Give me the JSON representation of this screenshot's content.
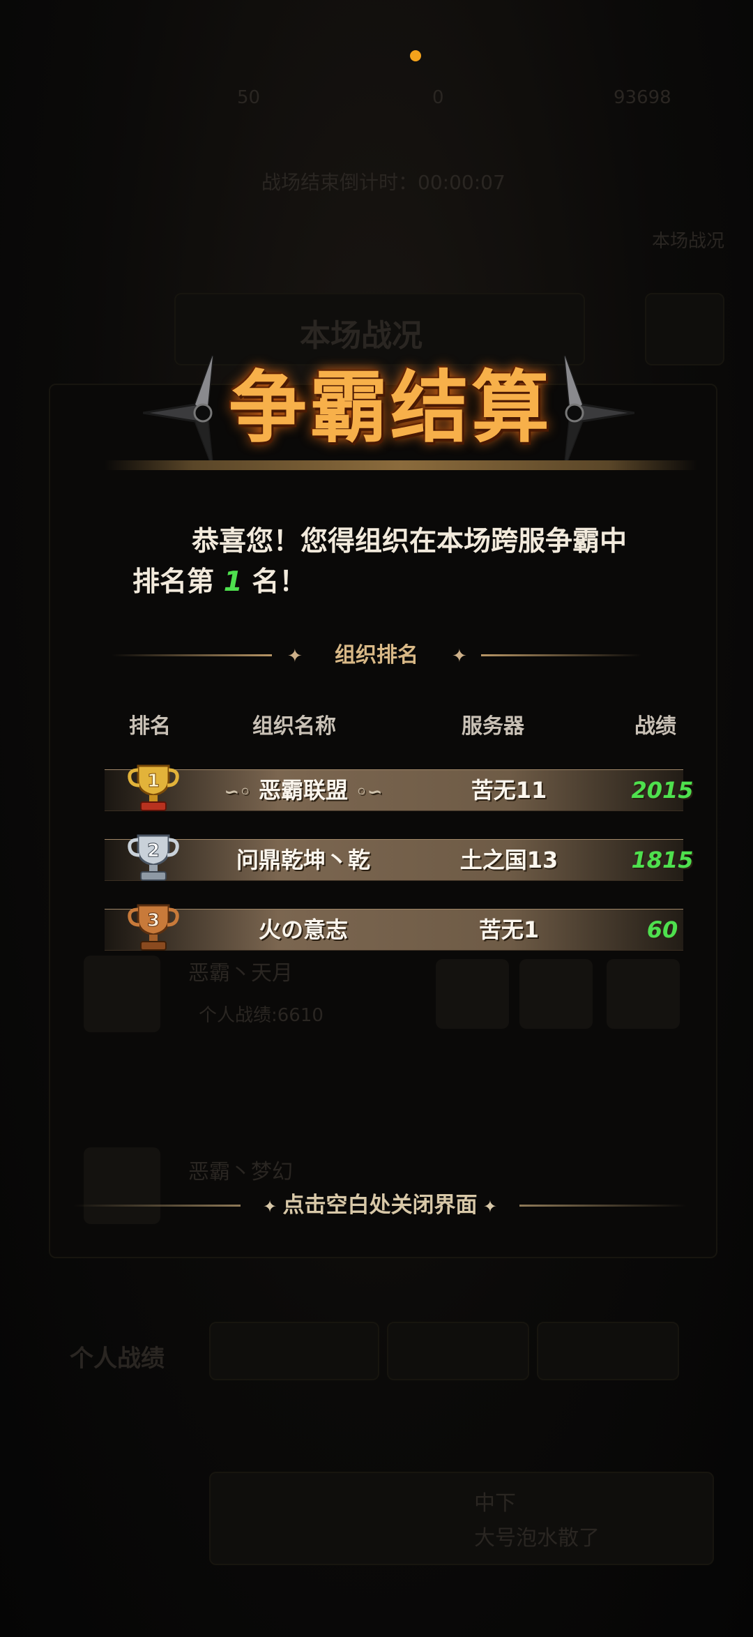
{
  "background": {
    "stat_1": "50",
    "stat_2": "0",
    "stat_3": "93698",
    "countdown": "战场结束倒计时：00:00:07",
    "side_label": "本场战况",
    "panel_title": "本场战况",
    "player_name": "恶霸丶天月",
    "player_score": "个人战绩:6610",
    "player_name_2": "恶霸丶梦幻",
    "tab_personal": "个人战绩",
    "chat_line_1": "中下",
    "chat_line_2": "大号泡水散了"
  },
  "modal": {
    "title": "争霸结算",
    "congrats_line1": "恭喜您！您得组织在本场跨服争霸中",
    "congrats_prefix": "排名第",
    "rank": "1",
    "congrats_suffix": "名！",
    "section_title": "组织排名",
    "columns": {
      "rank": "排名",
      "name": "组织名称",
      "server": "服务器",
      "score": "战绩"
    },
    "rows": [
      {
        "rank": "1",
        "name": "恶霸联盟",
        "server": "苦无11",
        "score": "2015"
      },
      {
        "rank": "2",
        "name": "问鼎乾坤丶乾",
        "server": "土之国13",
        "score": "1815"
      },
      {
        "rank": "3",
        "name": "火の意志",
        "server": "苦无1",
        "score": "60"
      }
    ],
    "close_hint": "点击空白处关闭界面"
  },
  "colors": {
    "accent_orange": "#f7b04a",
    "score_green": "#4ee04e",
    "gold": "#e2b33a",
    "silver": "#c9d1d9",
    "bronze": "#c87a3a"
  }
}
